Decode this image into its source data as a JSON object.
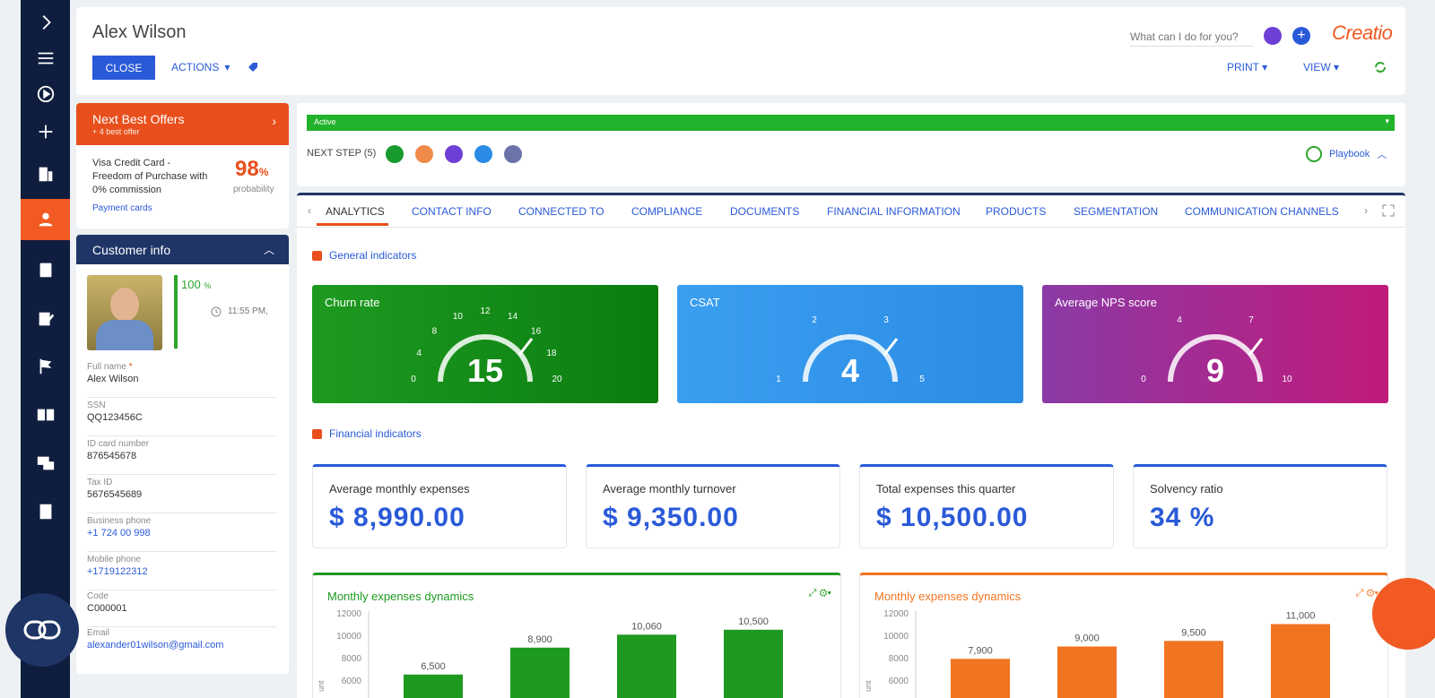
{
  "header": {
    "record_title": "Alex Wilson",
    "close_label": "CLOSE",
    "actions_label": "ACTIONS",
    "search_placeholder": "What can I do for you?",
    "logo": "Creatio",
    "print_label": "PRINT",
    "view_label": "VIEW"
  },
  "nbo": {
    "title": "Next Best Offers",
    "subtitle": "+ 4 best offer",
    "offer_name": "Visa Credit Card - Freedom of Purchase with 0% commission",
    "probability_value": "98",
    "probability_unit": "%",
    "probability_label": "probability",
    "link": "Payment cards"
  },
  "customer": {
    "title": "Customer info",
    "fill_percent": "100",
    "fill_unit": "%",
    "time": "11:55 PM,",
    "fields": [
      {
        "label": "Full name",
        "required": "*",
        "value": "Alex Wilson",
        "link": false
      },
      {
        "label": "SSN",
        "value": "QQ123456C",
        "link": false
      },
      {
        "label": "ID card number",
        "value": "876545678",
        "link": false
      },
      {
        "label": "Tax ID",
        "value": "5676545689",
        "link": false
      },
      {
        "label": "Business phone",
        "value": "+1 724 00 998",
        "link": true
      },
      {
        "label": "Mobile phone",
        "value": "+1719122312",
        "link": true
      },
      {
        "label": "Code",
        "value": "C000001",
        "link": false
      },
      {
        "label": "Email",
        "value": "alexander01wilson@gmail.com",
        "link": true
      }
    ]
  },
  "stage": {
    "label": "Active",
    "next_step": "NEXT STEP (5)",
    "playbook": "Playbook"
  },
  "tabs": [
    "ANALYTICS",
    "CONTACT INFO",
    "CONNECTED TO",
    "COMPLIANCE",
    "DOCUMENTS",
    "FINANCIAL INFORMATION",
    "PRODUCTS",
    "SEGMENTATION",
    "COMMUNICATION CHANNELS"
  ],
  "sections": {
    "general": "General indicators",
    "financial": "Financial indicators"
  },
  "gauges": [
    {
      "title": "Churn rate",
      "value": "15",
      "ticks": [
        "0",
        "4",
        "8",
        "10",
        "12",
        "14",
        "16",
        "18",
        "20"
      ],
      "color_a": "#1e9a20",
      "color_b": "#0b7d10"
    },
    {
      "title": "CSAT",
      "value": "4",
      "ticks": [
        "5",
        "3",
        "2",
        "1"
      ],
      "color_a": "#3a9ef0",
      "color_b": "#2b8ce4"
    },
    {
      "title": "Average NPS score",
      "value": "9",
      "ticks": [
        "0",
        "4",
        "7",
        "10"
      ],
      "color_a": "#8b3aa6",
      "color_b": "#c01a7a"
    }
  ],
  "financial": [
    {
      "label": "Average monthly expenses",
      "value": "$ 8,990.00"
    },
    {
      "label": "Average monthly turnover",
      "value": "$ 9,350.00"
    },
    {
      "label": "Total expenses this quarter",
      "value": "$ 10,500.00"
    },
    {
      "label": "Solvency ratio",
      "value": "34 %"
    }
  ],
  "chart_data": [
    {
      "type": "bar",
      "title": "Monthly expenses dynamics",
      "color": "#1e9a20",
      "y_ticks": [
        "12000",
        "10000",
        "8000",
        "6000"
      ],
      "ylabel": "unt",
      "values": [
        6500,
        8900,
        10060,
        10500
      ],
      "labels": [
        "6,500",
        "8,900",
        "10,060",
        "10,500"
      ]
    },
    {
      "type": "bar",
      "title": "Monthly expenses dynamics",
      "color": "#f27421",
      "y_ticks": [
        "12000",
        "10000",
        "8000",
        "6000"
      ],
      "ylabel": "unt",
      "values": [
        7900,
        9000,
        9500,
        11000
      ],
      "labels": [
        "7,900",
        "9,000",
        "9,500",
        "11,000"
      ]
    }
  ],
  "colors": {
    "brand": "#f15a22",
    "primary": "#2a5ad8",
    "rail": "#0f1d3f"
  },
  "icons": [
    "chevron-right-icon",
    "menu-icon",
    "play-circle-icon",
    "plus-icon",
    "building-icon",
    "user-icon",
    "clipboard-icon",
    "edit-icon",
    "flag-icon",
    "book-icon",
    "chat-icon",
    "document-icon"
  ]
}
